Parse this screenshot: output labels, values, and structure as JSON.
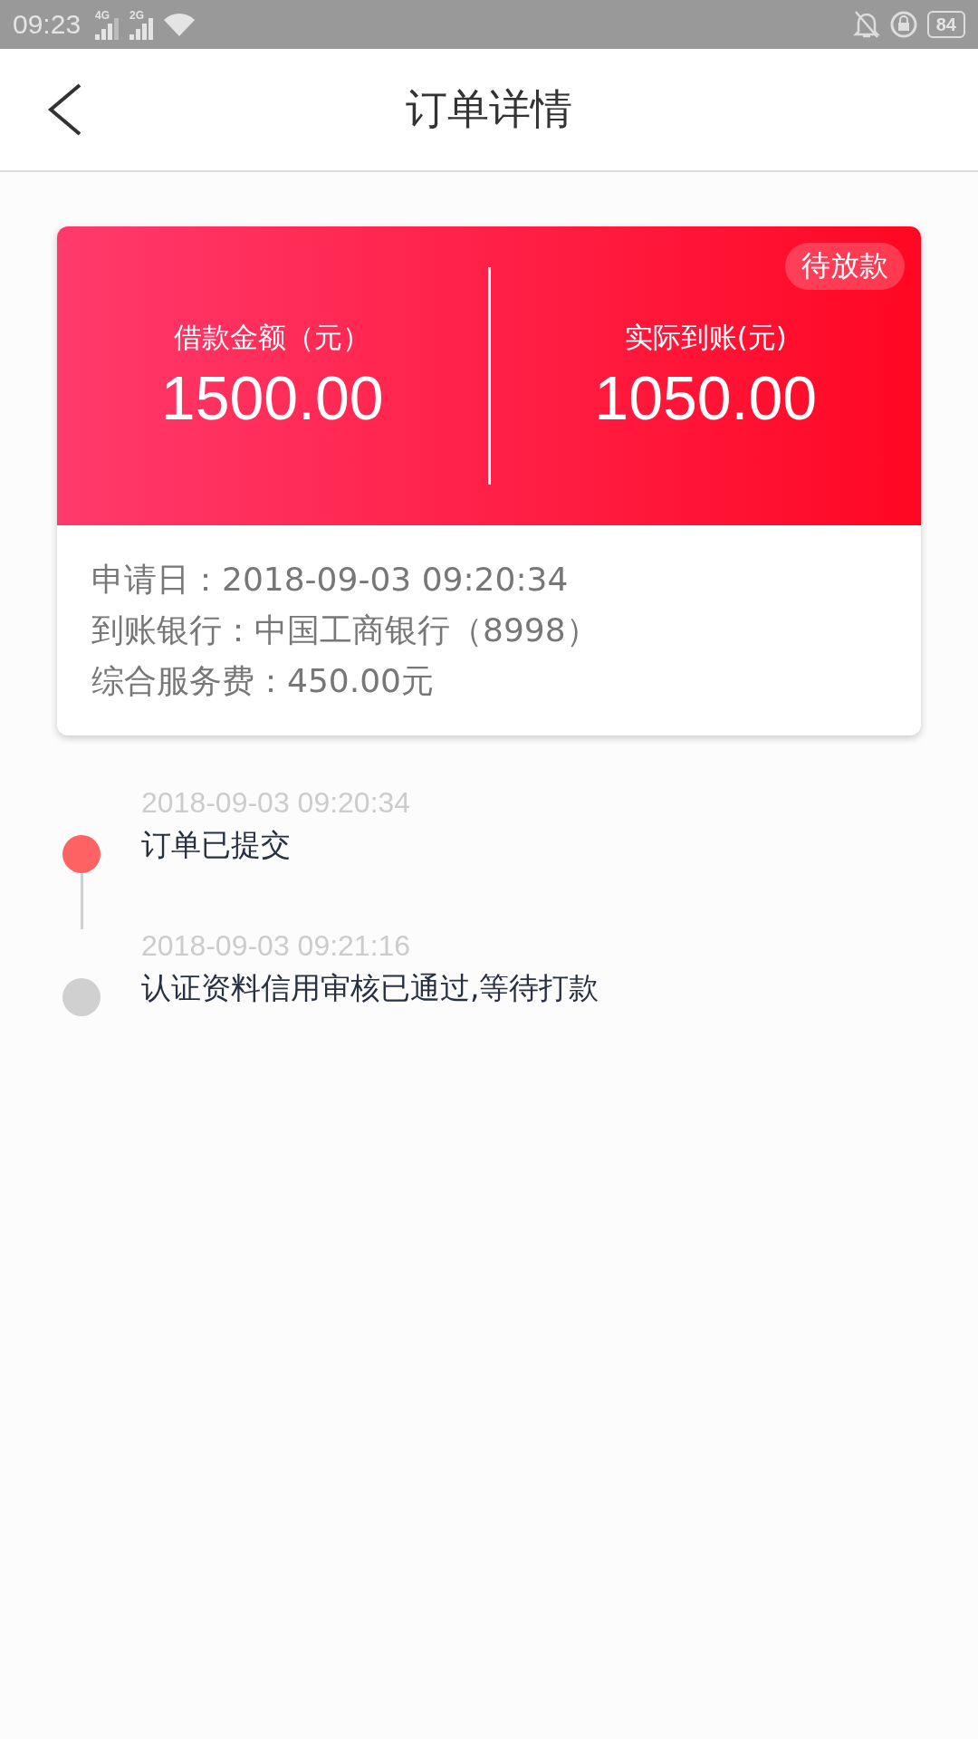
{
  "status_bar": {
    "time": "09:23",
    "signal_1": "4G",
    "signal_2": "2G",
    "battery": "84"
  },
  "header": {
    "title": "订单详情"
  },
  "card": {
    "badge": "待放款",
    "amounts": [
      {
        "label": "借款金额（元）",
        "value": "1500.00"
      },
      {
        "label": "实际到账(元)",
        "value": "1050.00"
      }
    ],
    "details": [
      "申请日：2018-09-03 09:20:34",
      "到账银行：中国工商银行（8998）",
      "综合服务费：450.00元"
    ]
  },
  "timeline": [
    {
      "time": "2018-09-03 09:20:34",
      "text": "订单已提交",
      "color": "#ff6262"
    },
    {
      "time": "2018-09-03 09:21:16",
      "text": "认证资料信用审核已通过,等待打款",
      "color": "#d0d0d0"
    }
  ]
}
